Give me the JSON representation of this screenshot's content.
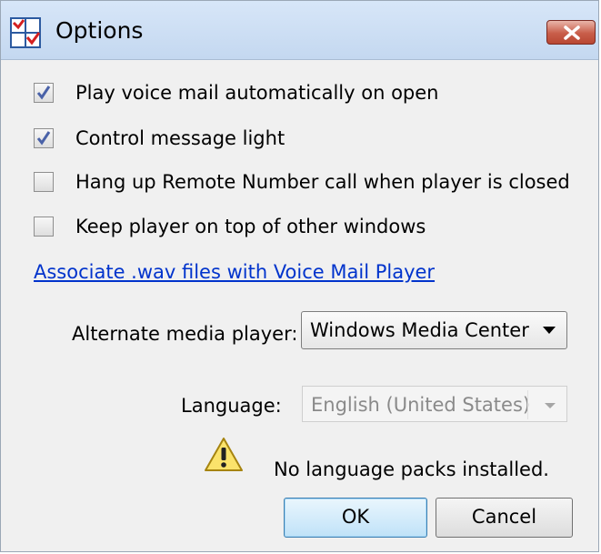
{
  "window": {
    "title": "Options",
    "icon": "options-app-icon",
    "close_icon": "close-x-icon",
    "accent": "#c85d49"
  },
  "options": [
    {
      "label": "Play voice mail automatically on open",
      "checked": true
    },
    {
      "label": "Control message light",
      "checked": true
    },
    {
      "label": "Hang up Remote Number call when player is closed",
      "checked": false
    },
    {
      "label": "Keep player on top of other windows",
      "checked": false
    }
  ],
  "associate_link": "Associate .wav files with Voice Mail Player",
  "media_player": {
    "label": "Alternate media player:",
    "value": "Windows Media Center"
  },
  "language": {
    "label": "Language:",
    "value": "English (United States)",
    "enabled": false
  },
  "warning": {
    "icon": "warning-triangle-icon",
    "text": "No language packs installed."
  },
  "buttons": {
    "ok": "OK",
    "cancel": "Cancel"
  }
}
